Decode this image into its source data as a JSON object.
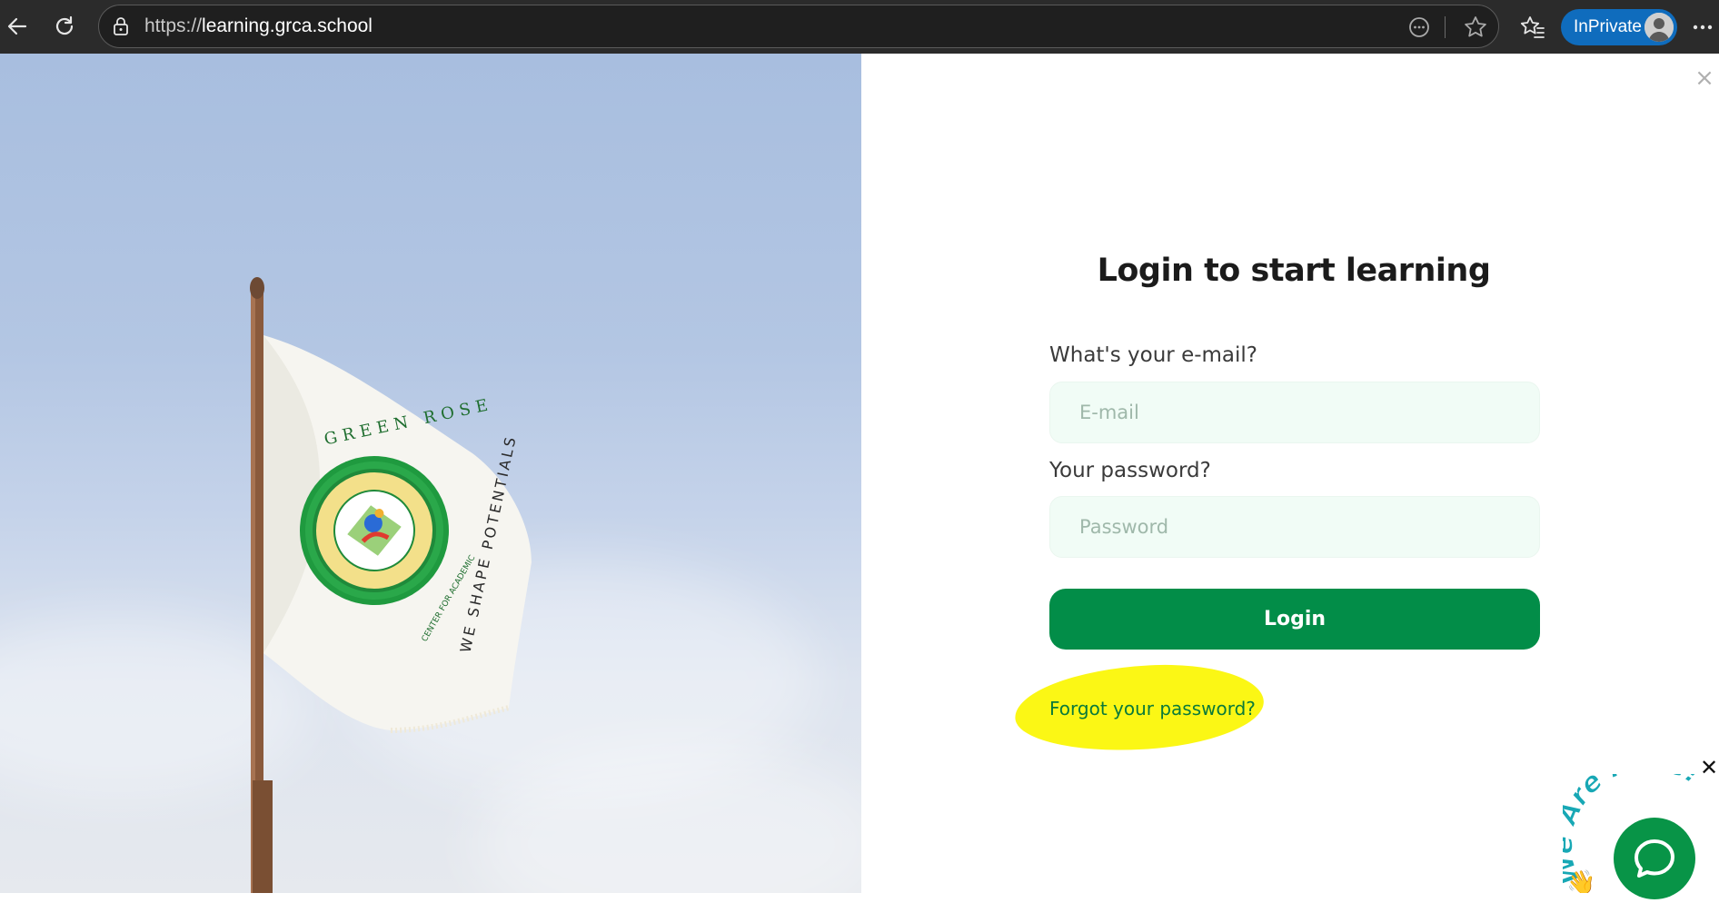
{
  "browser": {
    "url_scheme": "https://",
    "url_host": "learning.grca.school",
    "profile_label": "InPrivate",
    "icons": [
      "back-arrow-icon",
      "refresh-icon",
      "lock-icon",
      "reader-mode-icon",
      "star-icon",
      "favorites-icon",
      "avatar",
      "more-icon"
    ]
  },
  "photo": {
    "flag_ring_top": "GREEN ROSE",
    "flag_ring_bottom": "CENTER FOR ACADEMIC",
    "flag_motto": "WE SHAPE POTENTIALS"
  },
  "login": {
    "title": "Login to start learning",
    "email_label": "What's your e-mail?",
    "email_placeholder": "E-mail",
    "email_value": "",
    "password_label": "Your password?",
    "password_placeholder": "Password",
    "password_value": "",
    "login_button": "Login",
    "forgot_link": "Forgot your password?"
  },
  "chat_widget": {
    "tagline": "We Are Here!"
  },
  "colors": {
    "brand_green": "#028d48",
    "input_bg": "#f1fcf6",
    "highlight": "#fbf715",
    "chrome_bg": "#2b2b2b",
    "private_blue": "#0f6cbd"
  }
}
